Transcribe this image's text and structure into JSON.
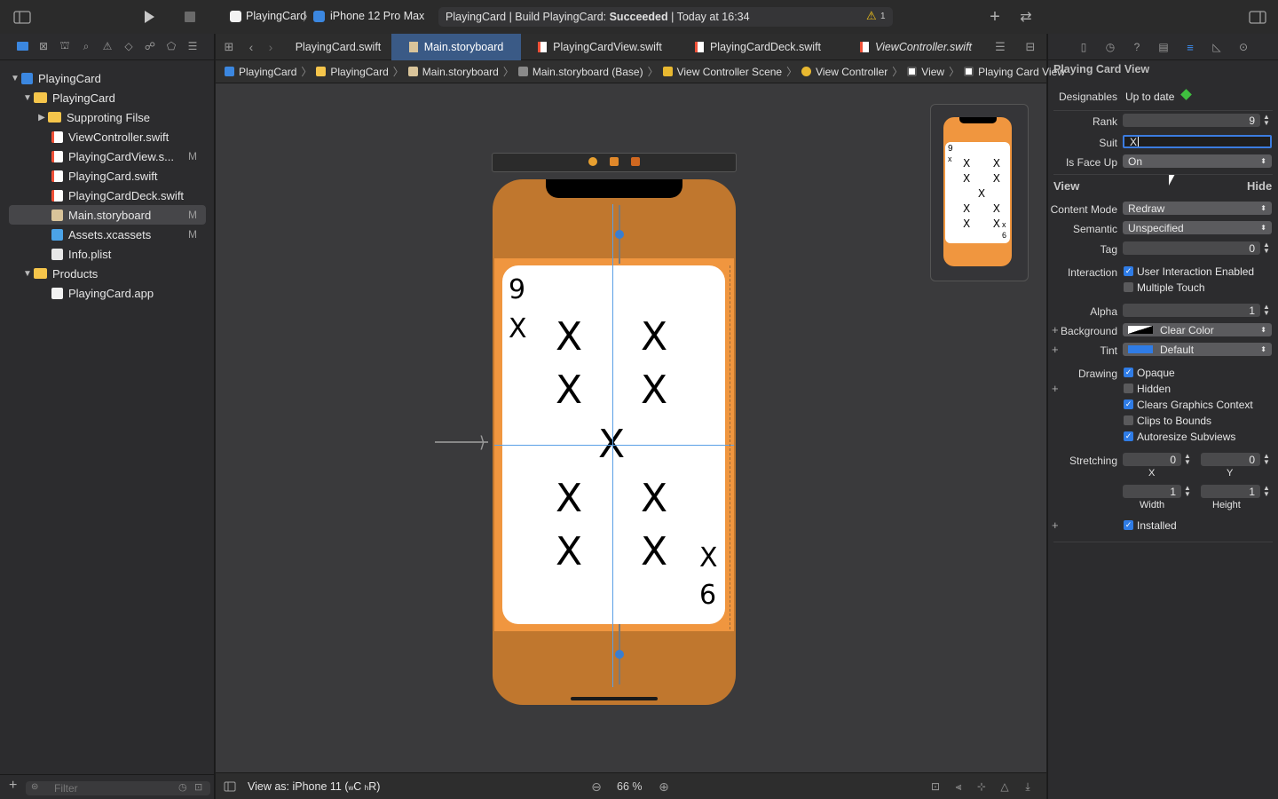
{
  "toolbar": {
    "scheme": "PlayingCard",
    "device": "iPhone 12 Pro Max",
    "status_prefix": "PlayingCard | Build PlayingCard: ",
    "status_result": "Succeeded",
    "status_time": " | Today at 16:34",
    "warning_count": "1"
  },
  "navigator": {
    "items": [
      {
        "label": "PlayingCard"
      },
      {
        "label": "PlayingCard"
      },
      {
        "label": "Supproting Filse"
      },
      {
        "label": "ViewController.swift"
      },
      {
        "label": "PlayingCardView.s...",
        "badge": "M"
      },
      {
        "label": "PlayingCard.swift"
      },
      {
        "label": "PlayingCardDeck.swift"
      },
      {
        "label": "Main.storyboard",
        "badge": "M"
      },
      {
        "label": "Assets.xcassets",
        "badge": "M"
      },
      {
        "label": "Info.plist"
      },
      {
        "label": "Products"
      },
      {
        "label": "PlayingCard.app"
      }
    ],
    "filter_placeholder": "Filter"
  },
  "tabs": [
    {
      "label": "PlayingCard.swift"
    },
    {
      "label": "Main.storyboard"
    },
    {
      "label": "PlayingCardView.swift"
    },
    {
      "label": "PlayingCardDeck.swift"
    },
    {
      "label": "ViewController.swift"
    }
  ],
  "breadcrumb": [
    {
      "label": "PlayingCard"
    },
    {
      "label": "PlayingCard"
    },
    {
      "label": "Main.storyboard"
    },
    {
      "label": "Main.storyboard (Base)"
    },
    {
      "label": "View Controller Scene"
    },
    {
      "label": "View Controller"
    },
    {
      "label": "View"
    },
    {
      "label": "Playing Card View"
    }
  ],
  "canvas": {
    "rank_corner": "9",
    "suit_corner": "X",
    "pip": "X",
    "rank_corner_flipped": "6",
    "mini_rank": "9",
    "mini_suit": "x",
    "mini_rank_flipped": "6"
  },
  "statusbar": {
    "view_as": "View as: iPhone 11 (",
    "view_as_w": "w",
    "view_as_c": "C ",
    "view_as_h": "h",
    "view_as_r": "R)",
    "zoom": "66 %"
  },
  "inspector": {
    "title": "Playing Card View",
    "designables_label": "Designables",
    "designables_value": "Up to date",
    "rank_label": "Rank",
    "rank_value": "9",
    "suit_label": "Suit",
    "suit_value": "X",
    "faceup_label": "Is Face Up",
    "faceup_value": "On",
    "view_section": "View",
    "hide_label": "Hide",
    "content_mode_label": "Content Mode",
    "content_mode_value": "Redraw",
    "semantic_label": "Semantic",
    "semantic_value": "Unspecified",
    "tag_label": "Tag",
    "tag_value": "0",
    "interaction_label": "Interaction",
    "user_interaction": "User Interaction Enabled",
    "multiple_touch": "Multiple Touch",
    "alpha_label": "Alpha",
    "alpha_value": "1",
    "background_label": "Background",
    "background_value": "Clear Color",
    "tint_label": "Tint",
    "tint_value": "Default",
    "drawing_label": "Drawing",
    "opaque": "Opaque",
    "hidden": "Hidden",
    "clears_context": "Clears Graphics Context",
    "clips_bounds": "Clips to Bounds",
    "autoresize": "Autoresize Subviews",
    "stretching_label": "Stretching",
    "stretch_x": "0",
    "stretch_y": "0",
    "x_label": "X",
    "y_label": "Y",
    "stretch_w": "1",
    "stretch_h": "1",
    "width_label": "Width",
    "height_label": "Height",
    "installed": "Installed",
    "colors": {
      "tint": "#2f7ce6",
      "designables_ok": "#3fbf3f"
    }
  }
}
